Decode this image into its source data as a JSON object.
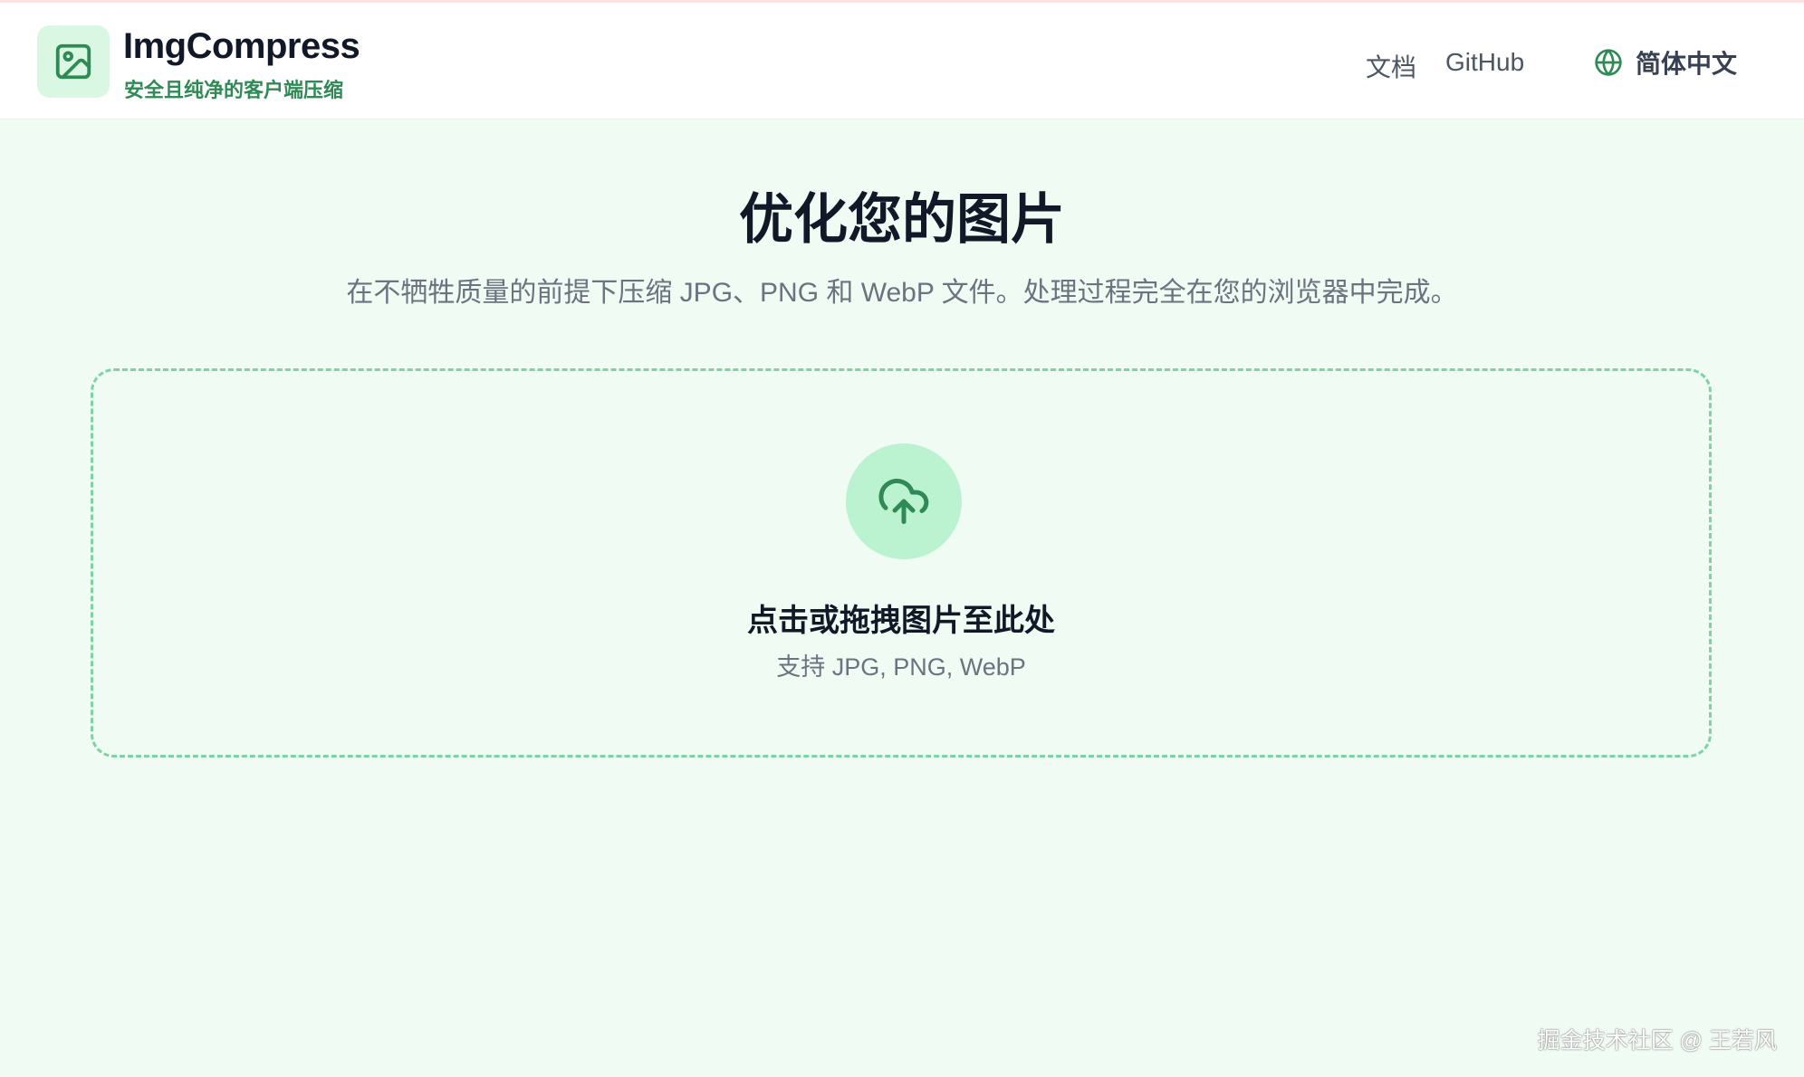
{
  "header": {
    "brand_title": "ImgCompress",
    "brand_subtitle": "安全且纯净的客户端压缩",
    "logo_icon": "image-icon",
    "nav": {
      "docs": "文档",
      "github": "GitHub"
    },
    "language": {
      "icon": "globe-icon",
      "selected": "简体中文"
    }
  },
  "hero": {
    "title": "优化您的图片",
    "subtitle": "在不牺牲质量的前提下压缩 JPG、PNG 和 WebP 文件。处理过程完全在您的浏览器中完成。"
  },
  "dropzone": {
    "icon": "cloud-upload-icon",
    "title": "点击或拖拽图片至此处",
    "subtitle": "支持 JPG, PNG, WebP"
  },
  "watermark": "掘金技术社区 @ 王若风",
  "colors": {
    "accent": "#2f8a55",
    "page_background": "#f0fbf3",
    "logo_background": "#d9f7e3",
    "upload_circle": "#bbf2d0",
    "dropzone_border": "#7dd3a4"
  }
}
